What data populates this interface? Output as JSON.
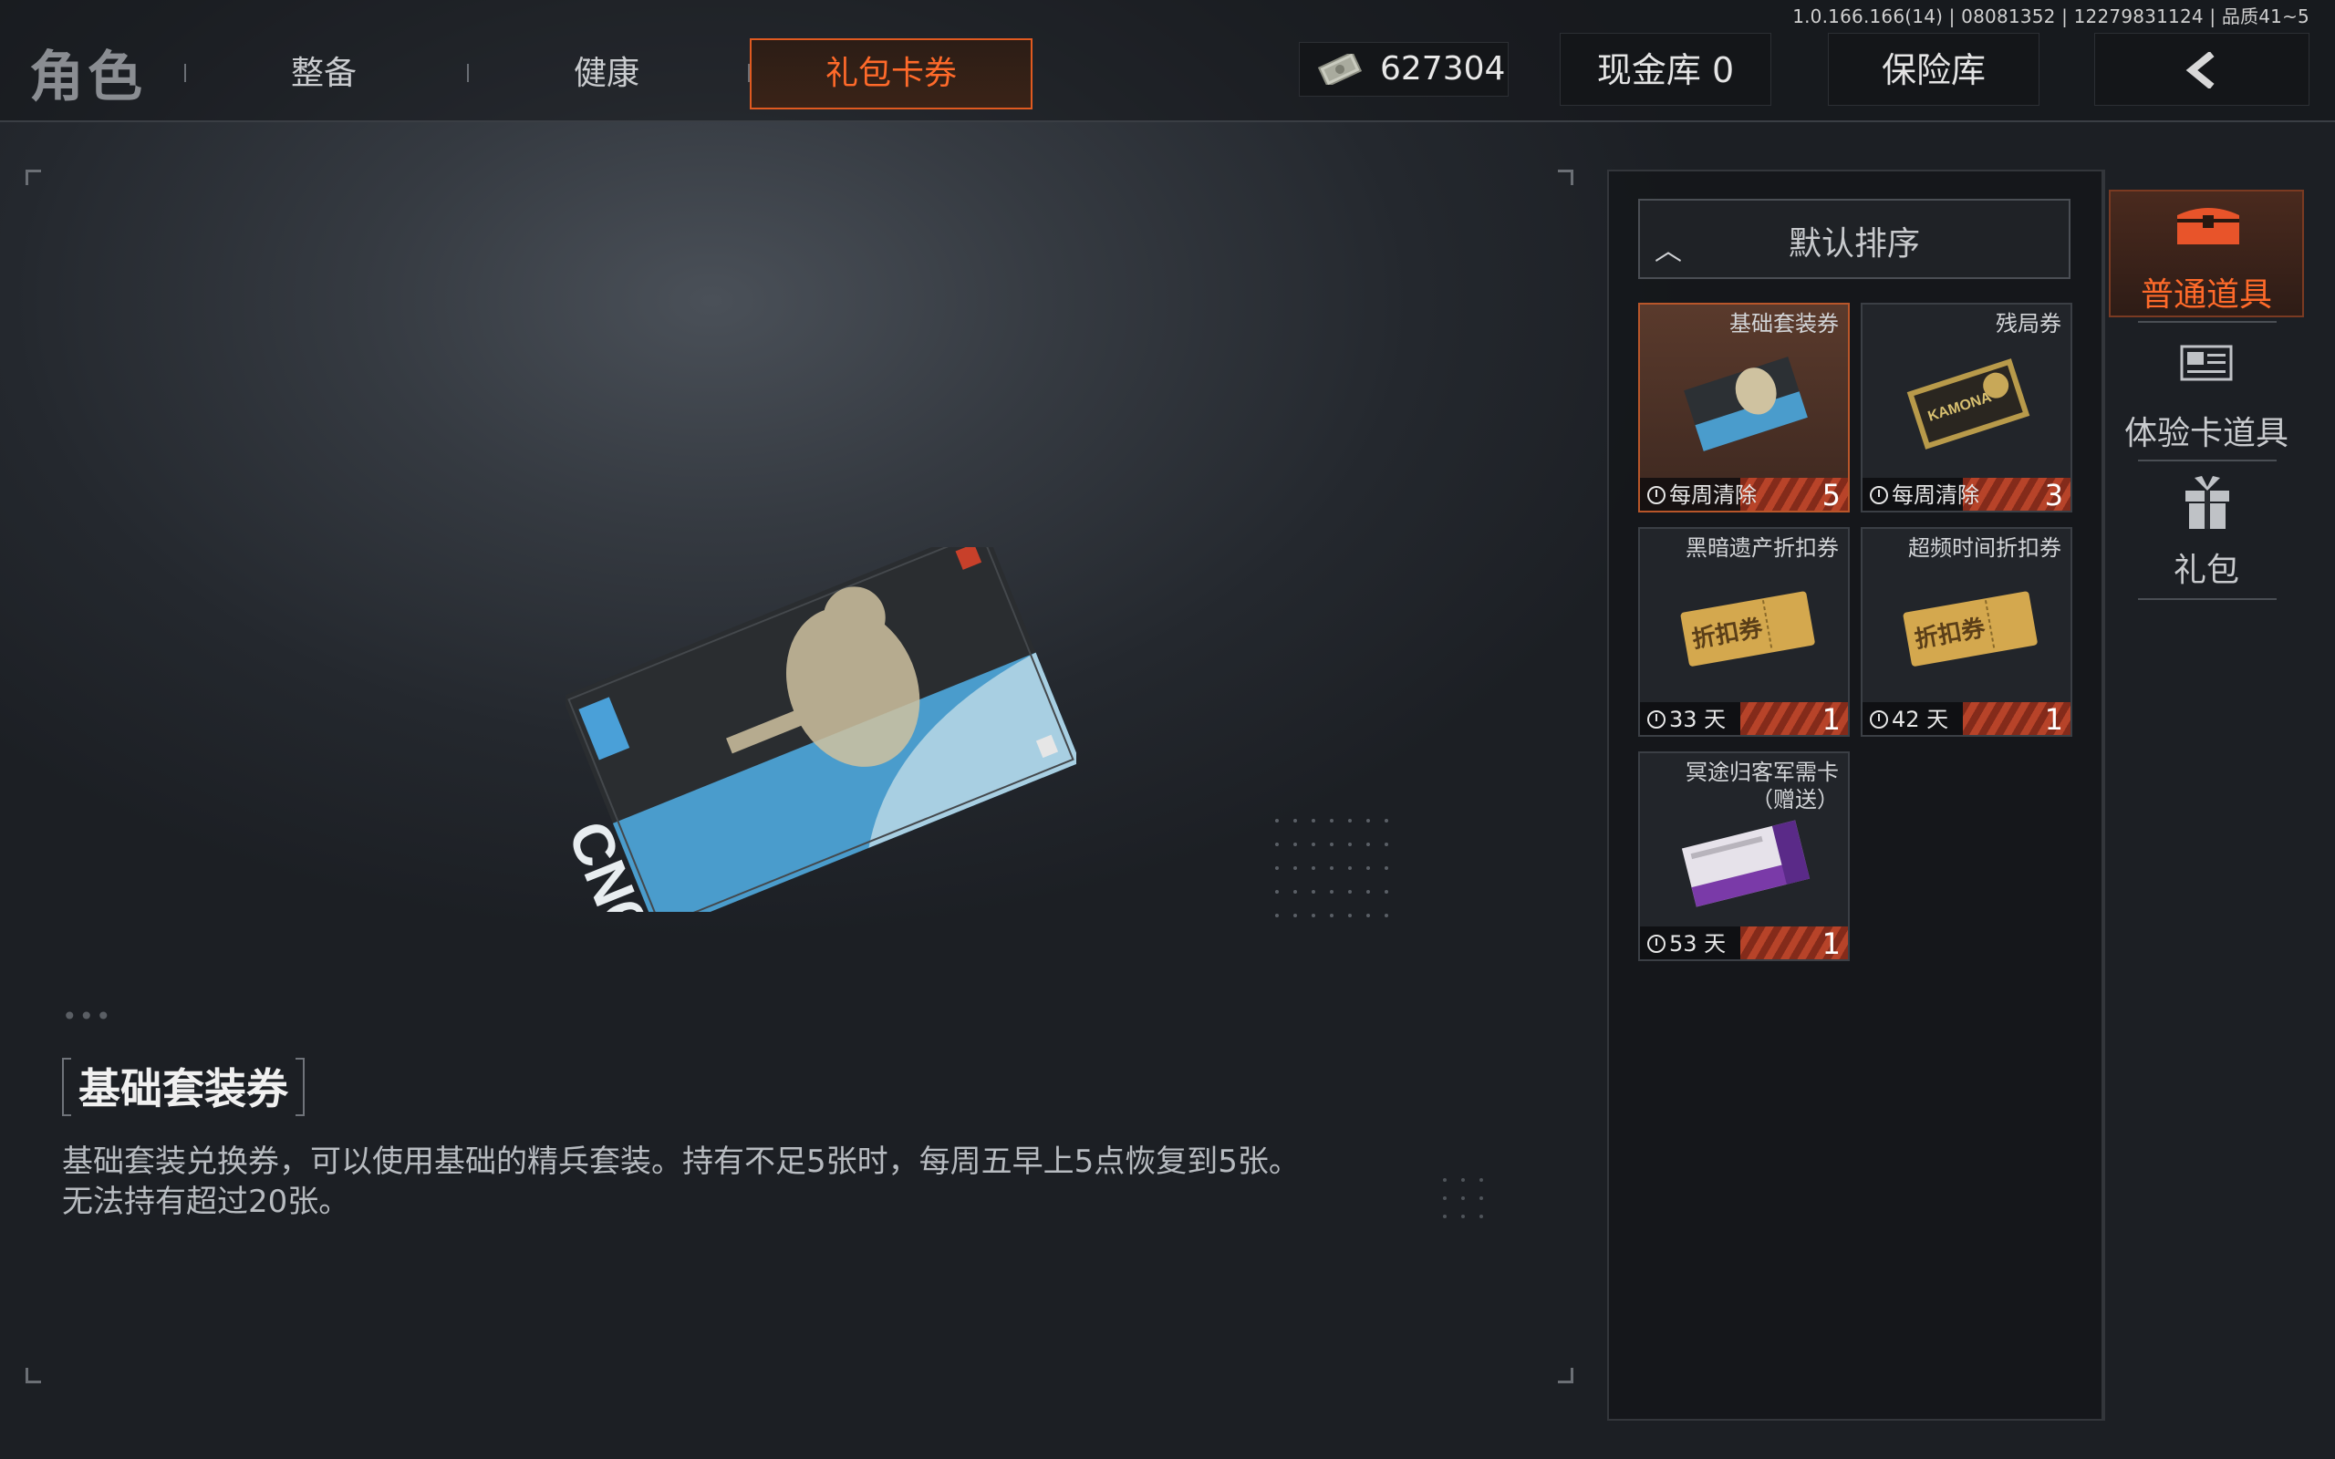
{
  "version": "1.0.166.166(14) | 08081352 | 12279831124 | 品质41~5",
  "header": {
    "title": "角色",
    "tabs": [
      {
        "label": "整备"
      },
      {
        "label": "健康"
      },
      {
        "label": "礼包卡券",
        "active": true
      }
    ],
    "currency_value": "627304",
    "cash_vault_label": "现金库 0",
    "safe_label": "保险库",
    "back_icon": "chevron-left-icon"
  },
  "detail": {
    "dots": "•••",
    "item_name": "基础套装券",
    "description": "基础套装兑换券，可以使用基础的精兵套装。持有不足5张时，每周五早上5点恢复到5张。无法持有超过20张。"
  },
  "inventory": {
    "sort_label": "默认排序",
    "items": [
      {
        "name": "基础套装券",
        "time": "每周清除",
        "count": "5",
        "selected": true
      },
      {
        "name": "残局券",
        "time": "每周清除",
        "count": "3"
      },
      {
        "name": "黑暗遗产折扣券",
        "time": "33 天",
        "count": "1"
      },
      {
        "name": "超频时间折扣券",
        "time": "42 天",
        "count": "1"
      },
      {
        "name": "冥途归客军需卡",
        "name2": "（赠送）",
        "time": "53 天",
        "count": "1"
      }
    ]
  },
  "categories": [
    {
      "label": "普通道具",
      "icon": "chest-icon",
      "active": true
    },
    {
      "label": "体验卡道具",
      "icon": "card-icon"
    },
    {
      "label": "礼包",
      "icon": "gift-icon"
    }
  ],
  "colors": {
    "accent": "#ff6a2a",
    "panel": "#141619",
    "stripe": "#c0462a"
  }
}
